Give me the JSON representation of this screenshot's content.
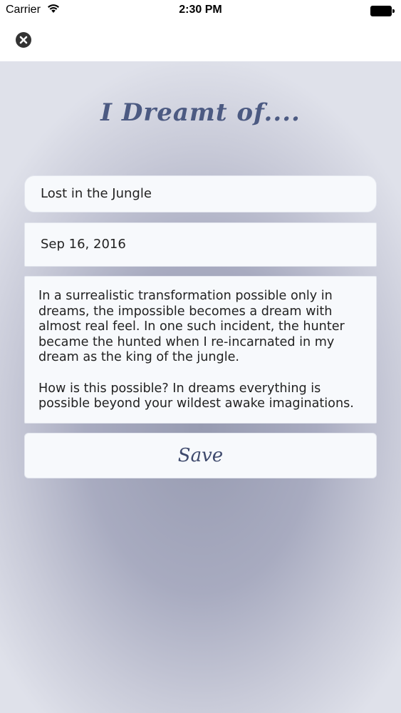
{
  "status_bar": {
    "carrier": "Carrier",
    "time": "2:30 PM"
  },
  "nav": {
    "close_icon": "close-circle-icon"
  },
  "screen": {
    "title": "I Dreamt of....",
    "dream_title_value": "Lost in the Jungle",
    "dream_date_value": "Sep 16, 2016",
    "dream_body_paragraphs": [
      "In a surrealistic transformation possible only in dreams, the impossible becomes a dream with almost real feel. In one such incident, the hunter became the hunted when I re-incarnated in my dream as the king of the jungle.",
      "How is this possible? In dreams everything is possible beyond your wildest awake imaginations."
    ],
    "save_label": "Save"
  },
  "colors": {
    "title": "#4c5a82",
    "field_background": "#f7f9fc",
    "background_center": "#979bb1",
    "background_edge": "#dfe1ea"
  }
}
